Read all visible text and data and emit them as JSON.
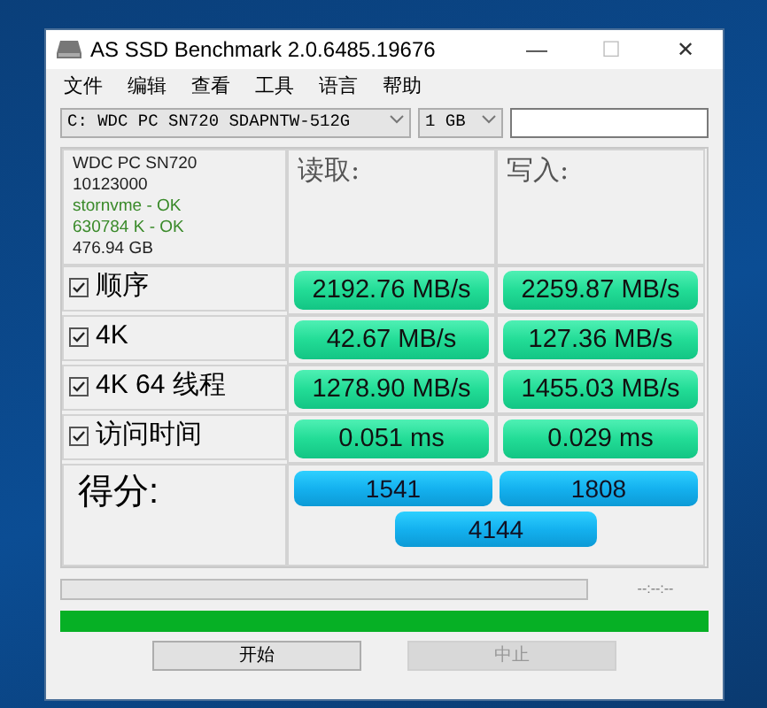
{
  "window": {
    "title": "AS SSD Benchmark 2.0.6485.19676",
    "controls": [
      "—",
      "☐",
      "✕"
    ]
  },
  "menu": [
    "文件",
    "编辑",
    "查看",
    "工具",
    "语言",
    "帮助"
  ],
  "drive_select": {
    "value": "C: WDC PC SN720 SDAPNTW-512G"
  },
  "size_select": {
    "value": "1 GB"
  },
  "drive_info": [
    {
      "text": "WDC PC SN720",
      "ok": false
    },
    {
      "text": "10123000",
      "ok": false
    },
    {
      "text": "stornvme - OK",
      "ok": true
    },
    {
      "text": "630784 K - OK",
      "ok": true
    },
    {
      "text": "476.94 GB",
      "ok": false
    }
  ],
  "columns": [
    "读取:",
    "写入:"
  ],
  "tests": [
    {
      "label": "顺序",
      "checked": true,
      "read": "2192.76 MB/s",
      "write": "2259.87 MB/s"
    },
    {
      "label": "4K",
      "checked": true,
      "read": "42.67 MB/s",
      "write": "127.36 MB/s"
    },
    {
      "label": "4K 64 线程",
      "checked": true,
      "read": "1278.90 MB/s",
      "write": "1455.03 MB/s"
    },
    {
      "label": "访问时间",
      "checked": true,
      "read": "0.051 ms",
      "write": "0.029 ms"
    }
  ],
  "score": {
    "label": "得分:",
    "read": "1541",
    "write": "1808",
    "total": "4144"
  },
  "progress": {
    "level": 0,
    "time": "--:--:--"
  },
  "overall_progress": {
    "level": 1
  },
  "buttons": [
    {
      "label": "开始",
      "disabled": false
    },
    {
      "label": "中止",
      "disabled": true
    }
  ]
}
